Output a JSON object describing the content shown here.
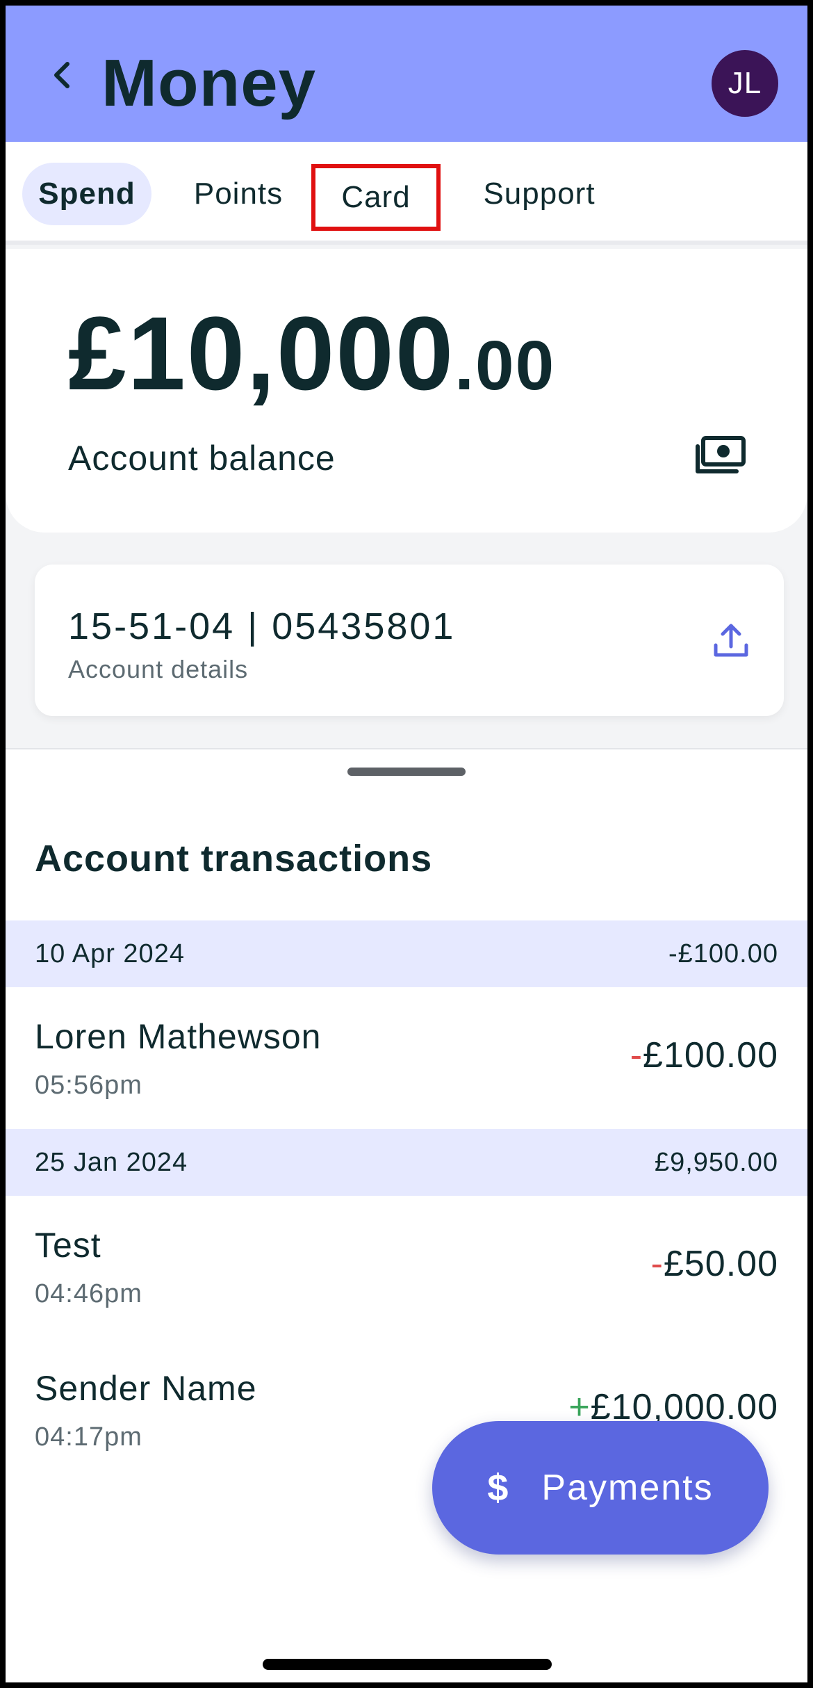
{
  "header": {
    "title": "Money",
    "avatar_initials": "JL",
    "back_icon": "chevron-left-icon"
  },
  "tabs": [
    {
      "label": "Spend",
      "active": true
    },
    {
      "label": "Points",
      "active": false
    },
    {
      "label": "Card",
      "active": false
    },
    {
      "label": "Support",
      "active": false
    }
  ],
  "balance": {
    "amount_main": "£10,000",
    "amount_decimal": ".00",
    "label": "Account balance",
    "icon": "cash-icon"
  },
  "account_details": {
    "number": "15-51-04 | 05435801",
    "label": "Account details",
    "icon": "share-upload-icon"
  },
  "transactions": {
    "title": "Account transactions",
    "groups": [
      {
        "date": "10 Apr 2024",
        "total": "-£100.00",
        "items": [
          {
            "name": "Loren Mathewson",
            "time": "05:56pm",
            "sign": "-",
            "amount": "£100.00"
          }
        ]
      },
      {
        "date": "25 Jan 2024",
        "total": "£9,950.00",
        "items": [
          {
            "name": "Test",
            "time": "04:46pm",
            "sign": "-",
            "amount": "£50.00"
          },
          {
            "name": "Sender Name",
            "time": "04:17pm",
            "sign": "+",
            "amount": "£10,000.00"
          }
        ]
      }
    ]
  },
  "fab": {
    "icon_glyph": "$",
    "label": "Payments"
  },
  "colors": {
    "header_bg": "#8c9bff",
    "accent": "#5b67e0",
    "avatar_bg": "#3b1457",
    "highlight_box": "#e01010",
    "negative": "#e04b4b",
    "positive": "#3aa55b"
  }
}
